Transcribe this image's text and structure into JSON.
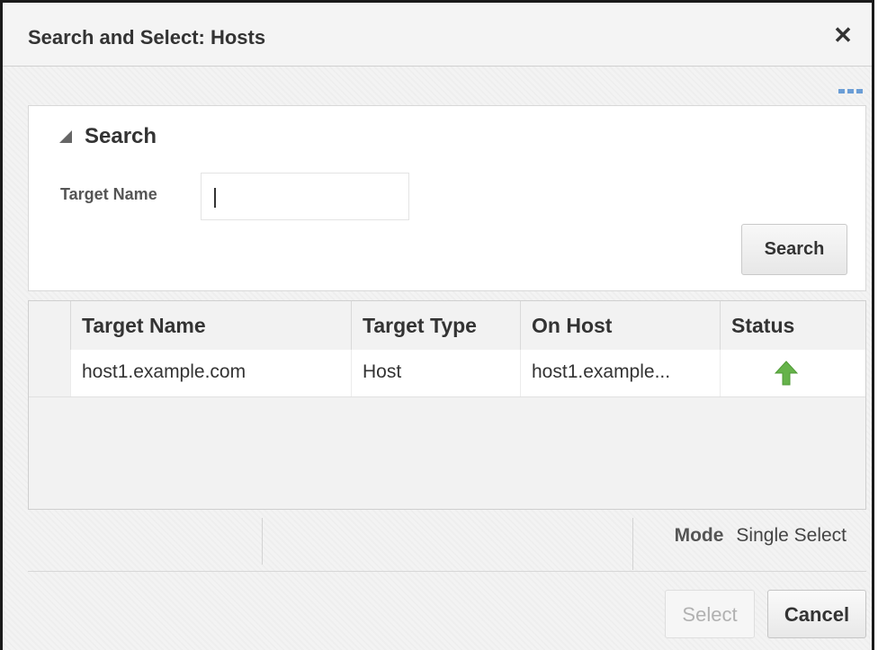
{
  "dialog": {
    "title": "Search and Select: Hosts",
    "close_symbol": "✕"
  },
  "search": {
    "heading": "Search",
    "field_label": "Target Name",
    "field_value": "",
    "button_label": "Search"
  },
  "table": {
    "columns": [
      "Target Name",
      "Target Type",
      "On Host",
      "Status"
    ],
    "rows": [
      {
        "target_name": "host1.example.com",
        "target_type": "Host",
        "on_host": "host1.example...",
        "status": "up-arrow-icon"
      }
    ]
  },
  "footer": {
    "mode_label": "Mode",
    "mode_value": "Single Select"
  },
  "actions": {
    "select_label": "Select",
    "cancel_label": "Cancel"
  },
  "colors": {
    "status_up": "#66b34a",
    "more_icon": "#6b9ed6"
  }
}
